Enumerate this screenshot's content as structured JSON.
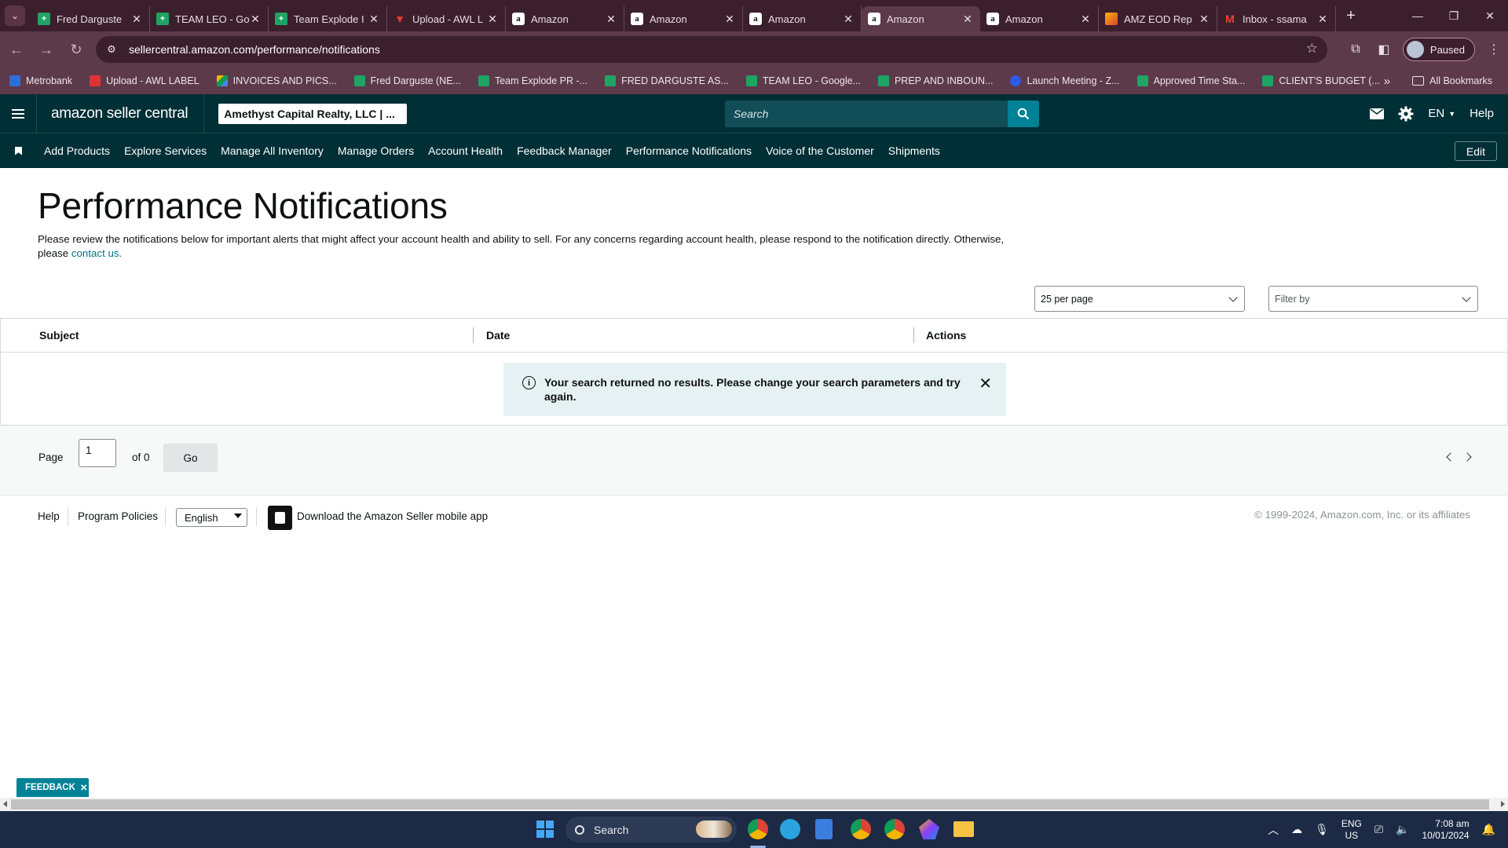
{
  "browser": {
    "tabs": [
      {
        "title": "Fred Darguste",
        "icon": "sheets-icon"
      },
      {
        "title": "TEAM LEO - Go",
        "icon": "sheets-icon"
      },
      {
        "title": "Team Explode I",
        "icon": "sheets-icon"
      },
      {
        "title": "Upload - AWL L",
        "icon": "awl-icon"
      },
      {
        "title": "Amazon",
        "icon": "amazon-icon"
      },
      {
        "title": "Amazon",
        "icon": "amazon-icon"
      },
      {
        "title": "Amazon",
        "icon": "amazon-icon"
      },
      {
        "title": "Amazon",
        "icon": "amazon-icon",
        "active": true
      },
      {
        "title": "Amazon",
        "icon": "amazon-icon"
      },
      {
        "title": "AMZ EOD Rep",
        "icon": "eod-icon"
      },
      {
        "title": "Inbox - ssama",
        "icon": "gmail-icon"
      }
    ],
    "url": "sellercentral.amazon.com/performance/notifications",
    "profile_label": "Paused",
    "bookmarks": [
      {
        "label": "Metrobank",
        "icon": "blue"
      },
      {
        "label": "Upload - AWL LABEL",
        "icon": "red"
      },
      {
        "label": "INVOICES AND PICS...",
        "icon": "drive"
      },
      {
        "label": "Fred Darguste (NE...",
        "icon": "sheet"
      },
      {
        "label": "Team Explode PR -...",
        "icon": "sheet"
      },
      {
        "label": "FRED DARGUSTE AS...",
        "icon": "sheet"
      },
      {
        "label": "TEAM LEO - Google...",
        "icon": "sheet"
      },
      {
        "label": "PREP AND INBOUN...",
        "icon": "sheet"
      },
      {
        "label": "Launch Meeting - Z...",
        "icon": "zoom"
      },
      {
        "label": "Approved Time Sta...",
        "icon": "sheet"
      },
      {
        "label": "CLIENT'S BUDGET (...",
        "icon": "sheet"
      }
    ],
    "all_bookmarks_label": "All Bookmarks"
  },
  "seller_central": {
    "logo_text": "amazon seller central",
    "account_name": "Amethyst Capital Realty, LLC | ...",
    "search_placeholder": "Search",
    "language": "EN",
    "help_label": "Help",
    "nav_links": [
      "Add Products",
      "Explore Services",
      "Manage All Inventory",
      "Manage Orders",
      "Account Health",
      "Feedback Manager",
      "Performance Notifications",
      "Voice of the Customer",
      "Shipments"
    ],
    "edit_label": "Edit"
  },
  "page": {
    "title": "Performance Notifications",
    "description": "Please review the notifications below for important alerts that might affect your account health and ability to sell. For any concerns regarding account health, please respond to the notification directly. Otherwise, please",
    "contact_link": "contact us.",
    "per_page_value": "25 per page",
    "filter_placeholder": "Filter by",
    "table_headers": [
      "Subject",
      "Date",
      "Actions"
    ],
    "alert_message": "Your search returned no results. Please change your search parameters and try again.",
    "pager": {
      "page_label": "Page",
      "page_value": "1",
      "of_label": "of 0",
      "go_label": "Go"
    }
  },
  "footer": {
    "help": "Help",
    "program_policies": "Program Policies",
    "language": "English",
    "app_link": "Download the Amazon Seller mobile app",
    "copyright": "© 1999-2024, Amazon.com, Inc. or its affiliates"
  },
  "feedback_label": "FEEDBACK",
  "taskbar": {
    "search_label": "Search",
    "lang_line1": "ENG",
    "lang_line2": "US",
    "time": "7:08 am",
    "date": "10/01/2024"
  }
}
